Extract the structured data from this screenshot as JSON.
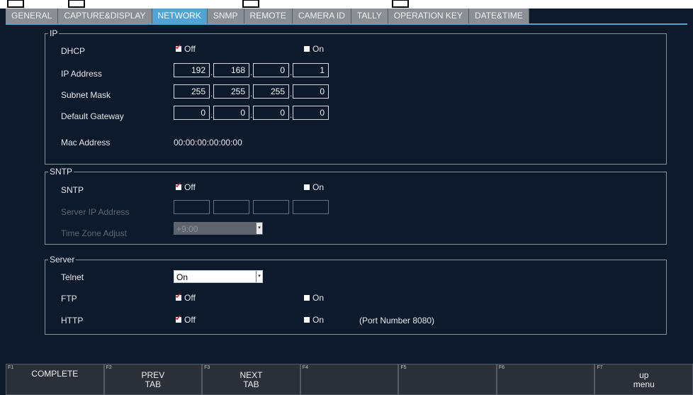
{
  "tabs": [
    "GENERAL",
    "CAPTURE&DISPLAY",
    "NETWORK",
    "SNMP",
    "REMOTE",
    "CAMERA ID",
    "TALLY",
    "OPERATION KEY",
    "DATE&TIME"
  ],
  "active_tab": "NETWORK",
  "ip": {
    "legend": "IP",
    "dhcp": {
      "label": "DHCP",
      "off": "Off",
      "on": "On",
      "selected": "Off"
    },
    "ip_address": {
      "label": "IP Address",
      "octets": [
        "192",
        "168",
        "0",
        "1"
      ]
    },
    "subnet_mask": {
      "label": "Subnet Mask",
      "octets": [
        "255",
        "255",
        "255",
        "0"
      ]
    },
    "default_gateway": {
      "label": "Default Gateway",
      "octets": [
        "0",
        "0",
        "0",
        "0"
      ]
    },
    "mac": {
      "label": "Mac Address",
      "value": "00:00:00:00:00:00"
    }
  },
  "sntp": {
    "legend": "SNTP",
    "sntp": {
      "label": "SNTP",
      "off": "Off",
      "on": "On",
      "selected": "Off"
    },
    "server_ip": {
      "label": "Server IP Address",
      "octets": [
        "",
        "",
        "",
        ""
      ]
    },
    "tz": {
      "label": "Time Zone Adjust",
      "value": "+9:00"
    }
  },
  "server": {
    "legend": "Server",
    "telnet": {
      "label": "Telnet",
      "value": "On"
    },
    "ftp": {
      "label": "FTP",
      "off": "Off",
      "on": "On",
      "selected": "Off"
    },
    "http": {
      "label": "HTTP",
      "off": "Off",
      "on": "On",
      "selected": "Off",
      "note": "(Port Number 8080)"
    }
  },
  "fkeys": [
    {
      "fn": "F1",
      "label": "COMPLETE"
    },
    {
      "fn": "F2",
      "label": "PREV\nTAB"
    },
    {
      "fn": "F3",
      "label": "NEXT\nTAB"
    },
    {
      "fn": "F4",
      "label": ""
    },
    {
      "fn": "F5",
      "label": ""
    },
    {
      "fn": "F6",
      "label": ""
    },
    {
      "fn": "F7",
      "label": "up\nmenu"
    }
  ],
  "colors": {
    "background": "#0c1a2c",
    "tab": "#8a8f96",
    "tab_active": "#4fa3d6",
    "check_mark": "#d8263a"
  }
}
